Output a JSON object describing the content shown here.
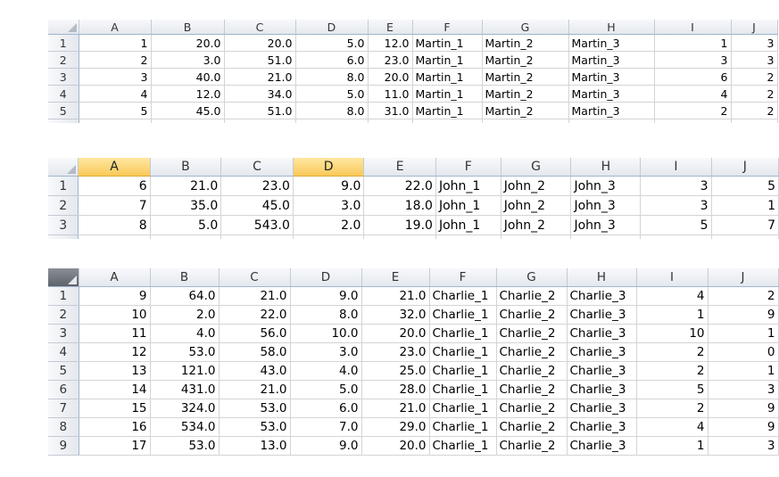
{
  "columns": [
    "A",
    "B",
    "C",
    "D",
    "E",
    "F",
    "G",
    "H",
    "I",
    "J"
  ],
  "sheet1": {
    "rows": [
      {
        "n": "1",
        "cells": [
          "1",
          "20.0",
          "20.0",
          "5.0",
          "12.0",
          "Martin_1",
          "Martin_2",
          "Martin_3",
          "1",
          "3"
        ]
      },
      {
        "n": "2",
        "cells": [
          "2",
          "3.0",
          "51.0",
          "6.0",
          "23.0",
          "Martin_1",
          "Martin_2",
          "Martin_3",
          "3",
          "3"
        ]
      },
      {
        "n": "3",
        "cells": [
          "3",
          "40.0",
          "21.0",
          "8.0",
          "20.0",
          "Martin_1",
          "Martin_2",
          "Martin_3",
          "6",
          "2"
        ]
      },
      {
        "n": "4",
        "cells": [
          "4",
          "12.0",
          "34.0",
          "5.0",
          "11.0",
          "Martin_1",
          "Martin_2",
          "Martin_3",
          "4",
          "2"
        ]
      },
      {
        "n": "5",
        "cells": [
          "5",
          "45.0",
          "51.0",
          "8.0",
          "31.0",
          "Martin_1",
          "Martin_2",
          "Martin_3",
          "2",
          "2"
        ]
      }
    ]
  },
  "sheet2": {
    "selected_columns": [
      "A",
      "D"
    ],
    "rows": [
      {
        "n": "1",
        "cells": [
          "6",
          "21.0",
          "23.0",
          "9.0",
          "22.0",
          "John_1",
          "John_2",
          "John_3",
          "3",
          "5"
        ]
      },
      {
        "n": "2",
        "cells": [
          "7",
          "35.0",
          "45.0",
          "3.0",
          "18.0",
          "John_1",
          "John_2",
          "John_3",
          "3",
          "1"
        ]
      },
      {
        "n": "3",
        "cells": [
          "8",
          "5.0",
          "543.0",
          "2.0",
          "19.0",
          "John_1",
          "John_2",
          "John_3",
          "5",
          "7"
        ]
      }
    ]
  },
  "sheet3": {
    "rows": [
      {
        "n": "1",
        "cells": [
          "9",
          "64.0",
          "21.0",
          "9.0",
          "21.0",
          "Charlie_1",
          "Charlie_2",
          "Charlie_3",
          "4",
          "2"
        ]
      },
      {
        "n": "2",
        "cells": [
          "10",
          "2.0",
          "22.0",
          "8.0",
          "32.0",
          "Charlie_1",
          "Charlie_2",
          "Charlie_3",
          "1",
          "9"
        ]
      },
      {
        "n": "3",
        "cells": [
          "11",
          "4.0",
          "56.0",
          "10.0",
          "20.0",
          "Charlie_1",
          "Charlie_2",
          "Charlie_3",
          "10",
          "1"
        ]
      },
      {
        "n": "4",
        "cells": [
          "12",
          "53.0",
          "58.0",
          "3.0",
          "23.0",
          "Charlie_1",
          "Charlie_2",
          "Charlie_3",
          "2",
          "0"
        ]
      },
      {
        "n": "5",
        "cells": [
          "13",
          "121.0",
          "43.0",
          "4.0",
          "25.0",
          "Charlie_1",
          "Charlie_2",
          "Charlie_3",
          "2",
          "1"
        ]
      },
      {
        "n": "6",
        "cells": [
          "14",
          "431.0",
          "21.0",
          "5.0",
          "28.0",
          "Charlie_1",
          "Charlie_2",
          "Charlie_3",
          "5",
          "3"
        ]
      },
      {
        "n": "7",
        "cells": [
          "15",
          "324.0",
          "53.0",
          "6.0",
          "21.0",
          "Charlie_1",
          "Charlie_2",
          "Charlie_3",
          "2",
          "9"
        ]
      },
      {
        "n": "8",
        "cells": [
          "16",
          "534.0",
          "53.0",
          "7.0",
          "29.0",
          "Charlie_1",
          "Charlie_2",
          "Charlie_3",
          "4",
          "9"
        ]
      },
      {
        "n": "9",
        "cells": [
          "17",
          "53.0",
          "13.0",
          "9.0",
          "20.0",
          "Charlie_1",
          "Charlie_2",
          "Charlie_3",
          "1",
          "3"
        ]
      }
    ]
  }
}
